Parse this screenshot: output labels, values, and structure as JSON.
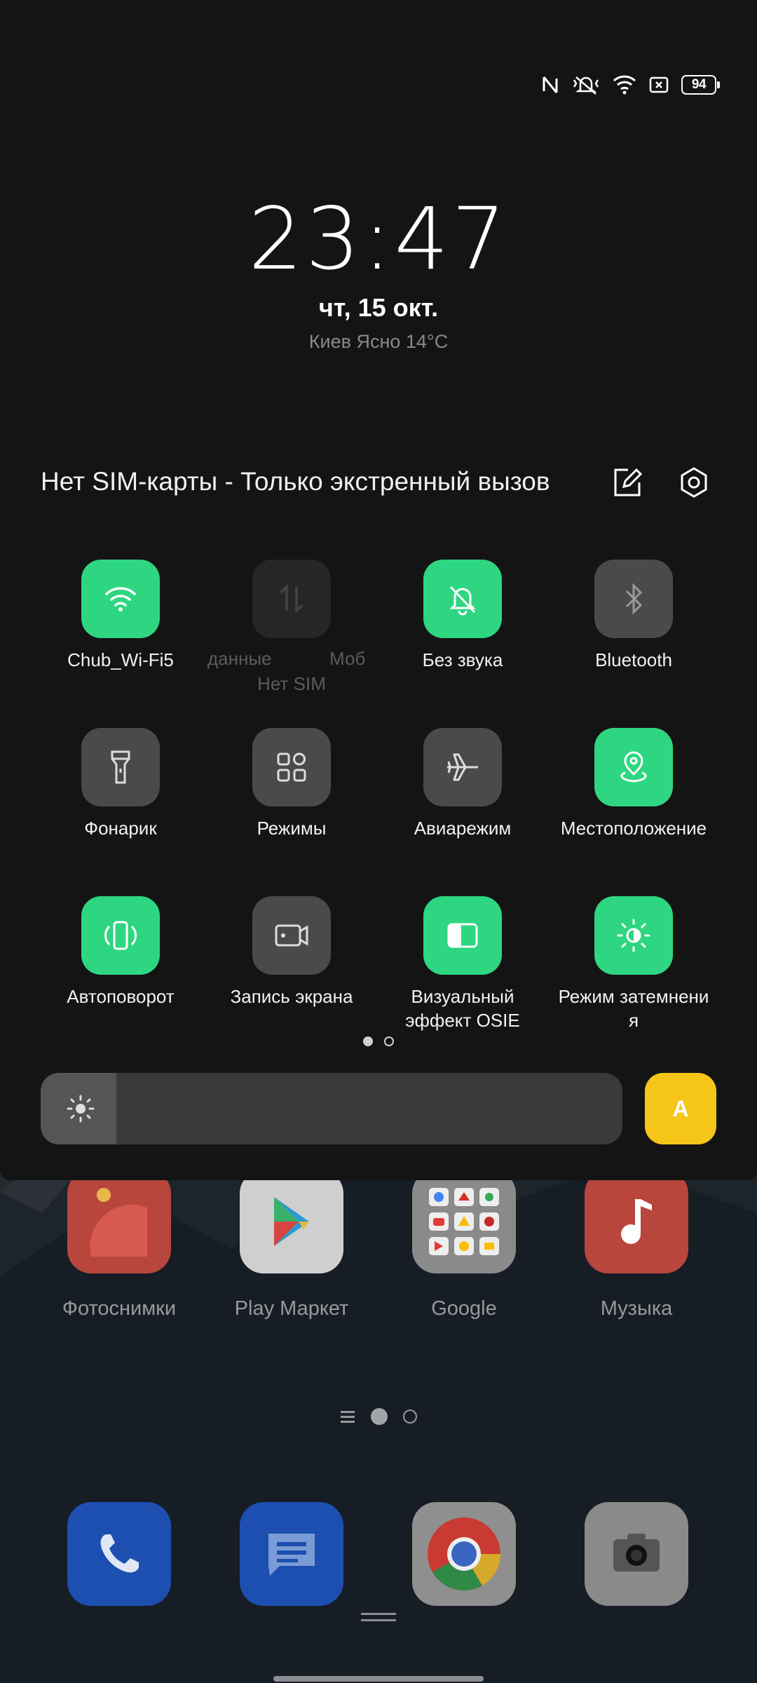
{
  "status_bar": {
    "icons": [
      "nfc-icon",
      "vibrate-icon",
      "wifi-icon",
      "no-sim-icon"
    ],
    "battery": "94"
  },
  "lockscreen": {
    "time": "23:47",
    "date": "чт, 15 окт.",
    "weather": "Киев Ясно 14°C"
  },
  "shade": {
    "sim_text": "Нет SIM-карты - Только экстренный вызов",
    "edit_icon": "edit-icon",
    "settings_icon": "settings-icon",
    "accent_color": "#2ed681"
  },
  "tiles": [
    {
      "label": "Chub_Wi-Fi5",
      "icon": "wifi-icon",
      "state": "on"
    },
    {
      "label_left": "данные",
      "label_right": "Моб",
      "sublabel": "Нет SIM",
      "icon": "mobile-data-icon",
      "state": "disabled"
    },
    {
      "label": "Без звука",
      "icon": "silent-bell-icon",
      "state": "on"
    },
    {
      "label": "Bluetooth",
      "icon": "bluetooth-icon",
      "state": "off"
    },
    {
      "label": "Фонарик",
      "icon": "flashlight-icon",
      "state": "off"
    },
    {
      "label": "Режимы",
      "icon": "modes-icon",
      "state": "off"
    },
    {
      "label": "Авиарежим",
      "icon": "airplane-icon",
      "state": "off"
    },
    {
      "label": "Местоположение",
      "icon": "location-icon",
      "state": "on"
    },
    {
      "label": "Автоповорот",
      "icon": "auto-rotate-icon",
      "state": "on"
    },
    {
      "label": "Запись экрана",
      "icon": "screen-record-icon",
      "state": "off"
    },
    {
      "label_line1": "Визуальный",
      "label_line2": "эффект OSIE",
      "icon": "osie-icon",
      "state": "on"
    },
    {
      "label_line1": "Режим затемнени",
      "label_line2": "я",
      "icon": "dim-mode-icon",
      "state": "on"
    }
  ],
  "pagination": {
    "pages": 2,
    "current": 1
  },
  "brightness": {
    "level": 0.13,
    "auto_label": "A",
    "auto_color": "#f5c518"
  },
  "home_apps": [
    {
      "label": "Фотоснимки",
      "icon": "photos-icon"
    },
    {
      "label": "Play Маркет",
      "icon": "play-store-icon"
    },
    {
      "label": "Google",
      "icon": "google-folder-icon"
    },
    {
      "label": "Музыка",
      "icon": "music-icon"
    }
  ],
  "dock": [
    {
      "icon": "phone-icon"
    },
    {
      "icon": "messages-icon"
    },
    {
      "icon": "chrome-icon"
    },
    {
      "icon": "camera-icon"
    }
  ]
}
